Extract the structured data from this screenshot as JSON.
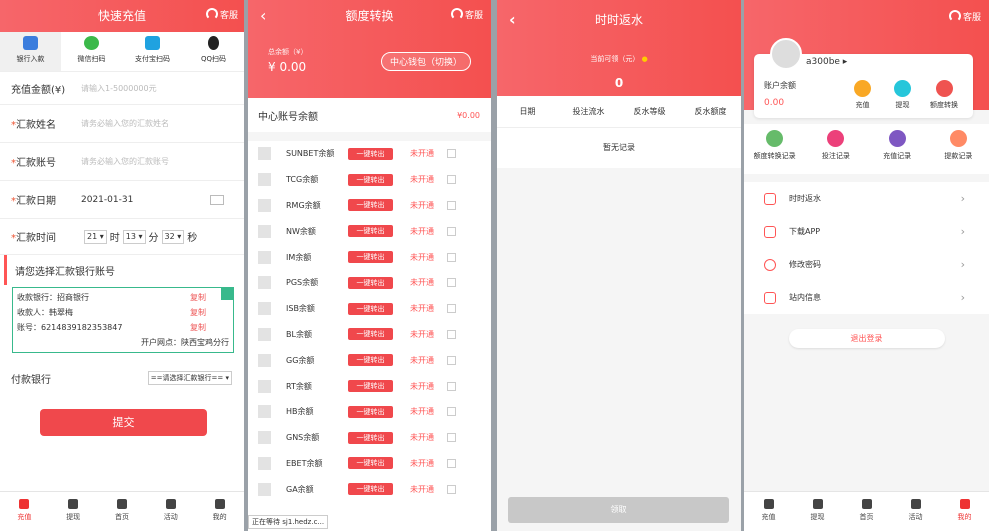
{
  "colors": {
    "primary": "#f4504f",
    "green": "#38b98c"
  },
  "p1": {
    "title": "快速充值",
    "service": "客服",
    "pay_tabs": [
      "银行入款",
      "微信扫码",
      "支付宝扫码",
      "QQ扫码"
    ],
    "amount_label": "充值金额(¥)",
    "amount_placeholder": "请输入1-5000000元",
    "name_label": "汇款姓名",
    "name_placeholder": "请务必输入您的汇款姓名",
    "acct_label": "汇款账号",
    "acct_placeholder": "请务必输入您的汇款账号",
    "date_label": "汇款日期",
    "date_value": "2021-01-31",
    "time_label": "汇款时间",
    "hour": "21",
    "hour_unit": "时",
    "minute": "13",
    "minute_unit": "分",
    "second": "32",
    "second_unit": "秒",
    "section": "请您选择汇款银行账号",
    "bank": {
      "line1": "收款银行：招商银行",
      "line2": "收款人：韩翠梅",
      "line3": "账号：6214839182353847",
      "branch": "开户网点：陕西宝鸡分行",
      "copy": "复制"
    },
    "pay_bank_label": "付款银行",
    "pay_bank_select": "==请选择汇款银行==",
    "submit": "提交"
  },
  "tabbar": [
    "充值",
    "提现",
    "首页",
    "活动",
    "我的"
  ],
  "p2": {
    "title": "额度转换",
    "service": "客服",
    "total_label": "总余额（¥）",
    "total_value": "¥ 0.00",
    "wallet_btn": "中心钱包（切换）",
    "center_label": "中心账号余额",
    "center_value": "¥0.00",
    "rows": [
      "SUNBET余额",
      "TCG余额",
      "RMG余额",
      "NW余额",
      "IM余额",
      "PGS余额",
      "ISB余额",
      "BL余额",
      "GG余额",
      "RT余额",
      "HB余额",
      "GNS余额",
      "EBET余额",
      "GA余额",
      "",
      ""
    ],
    "out": "一键转出",
    "status": "未开通",
    "loading": "正在等待 sj1.hedz.c..."
  },
  "p3": {
    "title": "时时返水",
    "can_label": "当前可领（元）",
    "amount": "0",
    "cols": [
      "日期",
      "投注流水",
      "反水等级",
      "反水额度"
    ],
    "empty": "暂无记录",
    "claim": "领取"
  },
  "p4": {
    "service": "客服",
    "user": "a300be ▸",
    "bal_label": "账户余额",
    "bal_value": "0.00",
    "actions": [
      "充值",
      "提现",
      "额度转换"
    ],
    "grid": [
      "额度转换记录",
      "投注记录",
      "充值记录",
      "提款记录"
    ],
    "menu": [
      "时时返水",
      "下载APP",
      "修改密码",
      "站内信息"
    ],
    "logout": "退出登录"
  }
}
